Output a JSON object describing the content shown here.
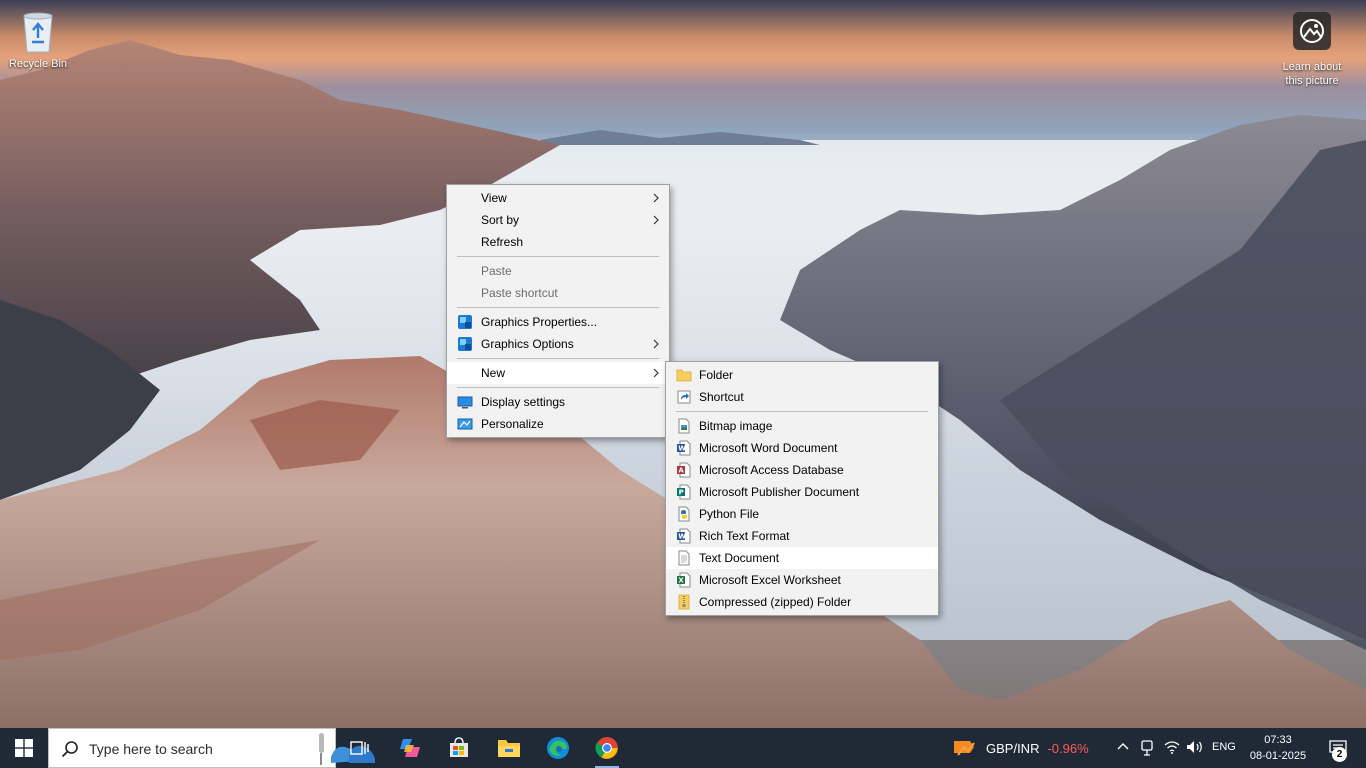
{
  "desktop": {
    "recycle_bin_label": "Recycle Bin",
    "learn_label_line1": "Learn about",
    "learn_label_line2": "this picture"
  },
  "context_menu": {
    "items": [
      {
        "label": "View",
        "submenu": true
      },
      {
        "label": "Sort by",
        "submenu": true
      },
      {
        "label": "Refresh"
      },
      {
        "label": "Paste",
        "disabled": true
      },
      {
        "label": "Paste shortcut",
        "disabled": true
      },
      {
        "label": "Graphics Properties...",
        "icon": "graphics-icon"
      },
      {
        "label": "Graphics Options",
        "icon": "graphics-icon",
        "submenu": true
      },
      {
        "label": "New",
        "submenu": true,
        "highlighted": true
      },
      {
        "label": "Display settings",
        "icon": "display-icon"
      },
      {
        "label": "Personalize",
        "icon": "personalize-icon"
      }
    ]
  },
  "new_submenu": {
    "items": [
      {
        "label": "Folder",
        "icon": "folder-icon"
      },
      {
        "label": "Shortcut",
        "icon": "shortcut-icon"
      },
      {
        "label": "Bitmap image",
        "icon": "bitmap-icon"
      },
      {
        "label": "Microsoft Word Document",
        "icon": "word-icon"
      },
      {
        "label": "Microsoft Access Database",
        "icon": "access-icon"
      },
      {
        "label": "Microsoft Publisher Document",
        "icon": "publisher-icon"
      },
      {
        "label": "Python File",
        "icon": "python-icon"
      },
      {
        "label": "Rich Text Format",
        "icon": "rtf-icon"
      },
      {
        "label": "Text Document",
        "icon": "text-document-icon",
        "highlighted": true
      },
      {
        "label": "Microsoft Excel Worksheet",
        "icon": "excel-icon"
      },
      {
        "label": "Compressed (zipped) Folder",
        "icon": "zip-folder-icon"
      }
    ]
  },
  "taskbar": {
    "search_placeholder": "Type here to search",
    "fx_pair": "GBP/INR",
    "fx_change": "-0.96%",
    "language": "ENG",
    "time": "07:33",
    "date": "08-01-2025",
    "notification_count": "2"
  },
  "colors": {
    "taskbar_bg": "#1f2a36",
    "menu_bg": "#f2f2f2",
    "fx_negative": "#ff5a5a",
    "accent": "#8fb7e8"
  }
}
